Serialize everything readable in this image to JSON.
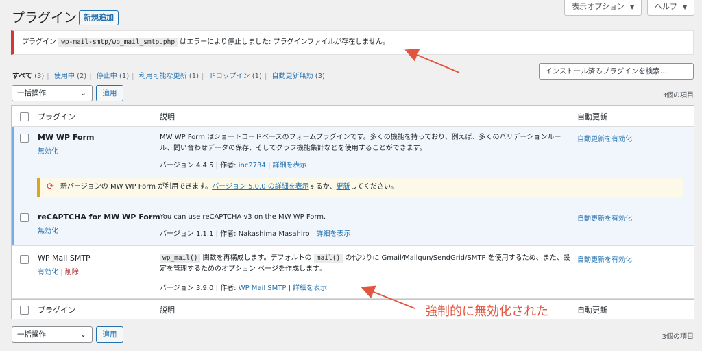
{
  "header": {
    "title": "プラグイン",
    "add_new": "新規追加",
    "screen_options": "表示オプション",
    "help": "ヘルプ"
  },
  "notice": {
    "prefix": "プラグイン",
    "code": "wp-mail-smtp/wp_mail_smtp.php",
    "suffix": "はエラーにより停止しました: プラグインファイルが存在しません。"
  },
  "filters": {
    "all": "すべて",
    "all_count": "(3)",
    "active": "使用中",
    "active_count": "(2)",
    "inactive": "停止中",
    "inactive_count": "(1)",
    "update": "利用可能な更新",
    "update_count": "(1)",
    "dropins": "ドロップイン",
    "dropins_count": "(1)",
    "auto_disabled": "自動更新無効",
    "auto_disabled_count": "(3)"
  },
  "search": {
    "placeholder": "インストール済みプラグインを検索..."
  },
  "bulk": {
    "label": "一括操作",
    "apply": "適用",
    "count": "3個の項目"
  },
  "columns": {
    "plugin": "プラグイン",
    "description": "説明",
    "auto_update": "自動更新"
  },
  "plugins": [
    {
      "name": "MW WP Form",
      "action1": "無効化",
      "desc": "MW WP Form はショートコードベースのフォームプラグインです。多くの機能を持っており、例えば、多くのバリデーションルール、問い合わせデータの保存、そしてグラフ機能集計などを使用することができます。",
      "version": "バージョン 4.4.5 | 作者: ",
      "author": "inc2734",
      "details": "詳細を表示",
      "auto": "自動更新を有効化",
      "update_text1": "新バージョンの MW WP Form が利用できます。",
      "update_link1": "バージョン 5.0.0 の詳細を表示",
      "update_text2": "するか、",
      "update_link2": "更新",
      "update_text3": "してください。"
    },
    {
      "name": "reCAPTCHA for MW WP Form",
      "action1": "無効化",
      "desc": "You can use reCAPTCHA v3 on the MW WP Form.",
      "version": "バージョン 1.1.1 | 作者: Nakashima Masahiro |",
      "details": "詳細を表示",
      "auto": "自動更新を有効化"
    },
    {
      "name": "WP Mail SMTP",
      "action1": "有効化",
      "action2": "削除",
      "code1": "wp_mail()",
      "desc1": "関数を再構成します。デフォルトの",
      "code2": "mail()",
      "desc2": "の代わりに Gmail/Mailgun/SendGrid/SMTP を使用するため、また、設定を管理するためのオプション ページを作成します。",
      "version": "バージョン 3.9.0 | 作者: ",
      "author": "WP Mail SMTP",
      "details": "詳細を表示",
      "auto": "自動更新を有効化"
    }
  ],
  "annotation": "強制的に無効化された",
  "colors": {
    "accent": "#2271b1",
    "error": "#d63638",
    "annotation": "#e2553f"
  }
}
